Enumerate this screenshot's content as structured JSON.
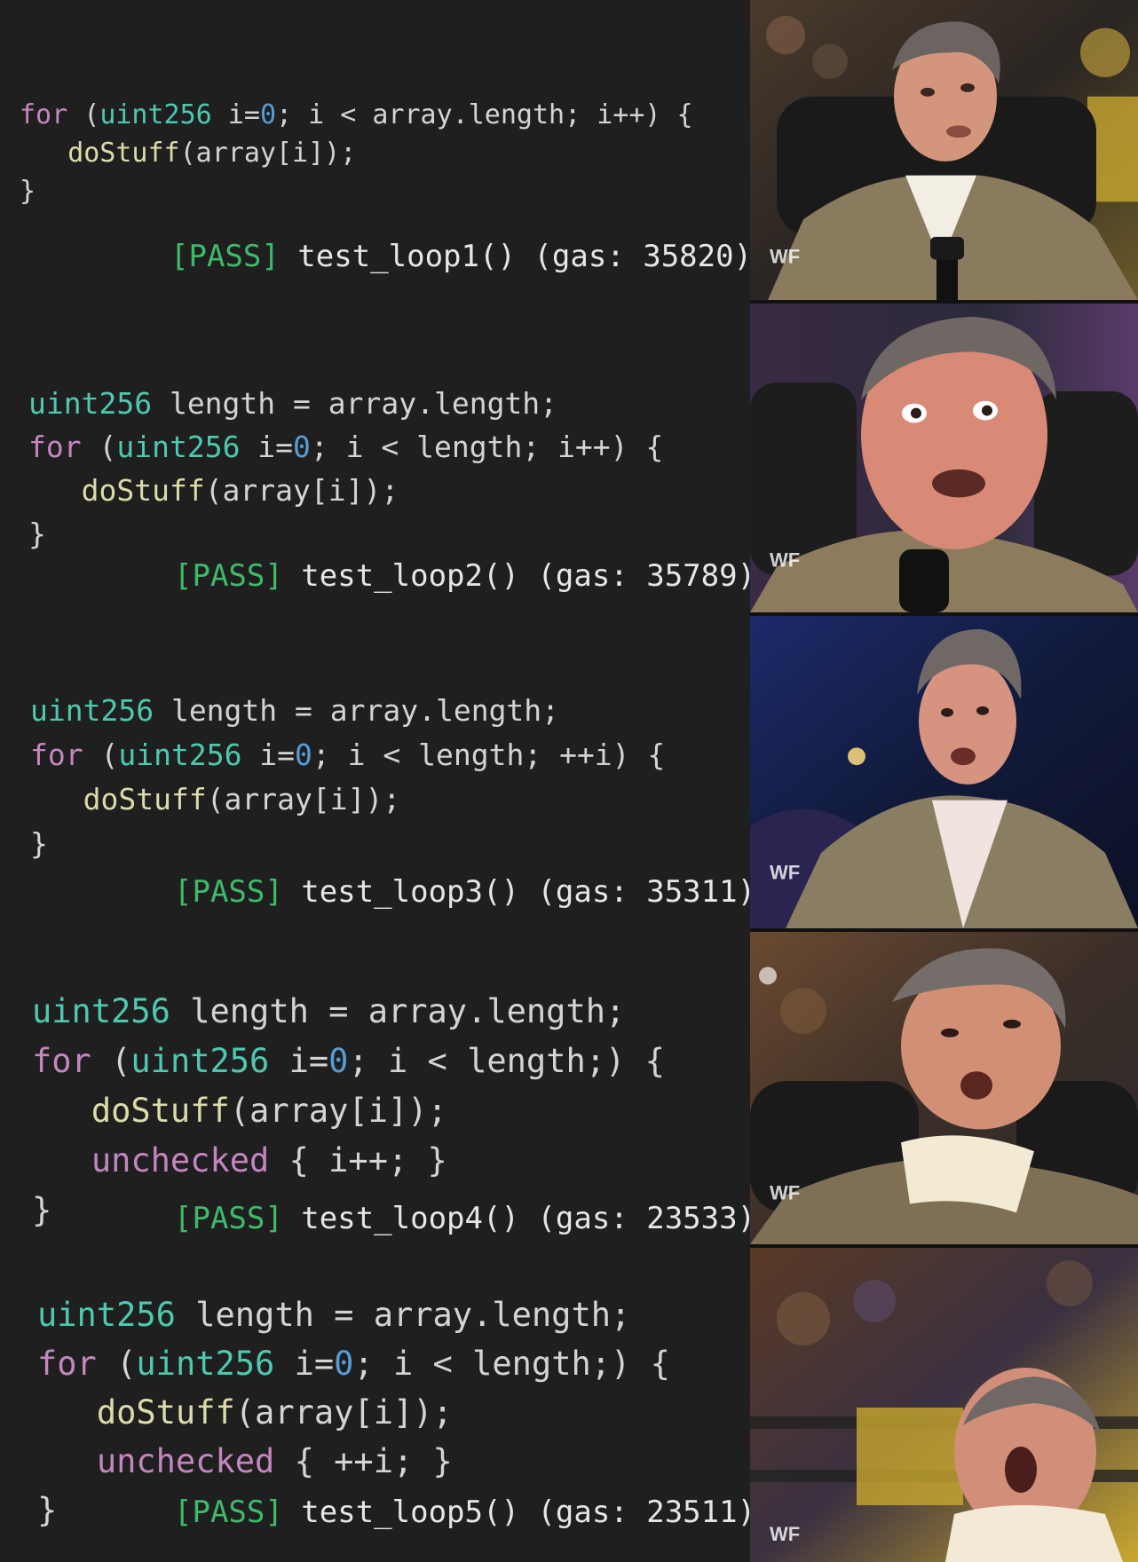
{
  "panels": [
    {
      "code_lines": [
        [
          {
            "t": "for",
            "c": "kw"
          },
          {
            "t": " (",
            "c": "pl"
          },
          {
            "t": "uint256",
            "c": "ty"
          },
          {
            "t": " i=",
            "c": "pl"
          },
          {
            "t": "0",
            "c": "nm"
          },
          {
            "t": "; i < array.length; i++) {",
            "c": "pl"
          }
        ],
        [
          {
            "t": "   ",
            "c": "pl"
          },
          {
            "t": "doStuff",
            "c": "fn"
          },
          {
            "t": "(array[i]);",
            "c": "pl"
          }
        ],
        [
          {
            "t": "}",
            "c": "pl"
          }
        ]
      ],
      "pass": "[PASS]",
      "test": " test_loop1() (gas: 35820)"
    },
    {
      "code_lines": [
        [
          {
            "t": "uint256",
            "c": "ty"
          },
          {
            "t": " length = array.length;",
            "c": "pl"
          }
        ],
        [
          {
            "t": "for",
            "c": "kw"
          },
          {
            "t": " (",
            "c": "pl"
          },
          {
            "t": "uint256",
            "c": "ty"
          },
          {
            "t": " i=",
            "c": "pl"
          },
          {
            "t": "0",
            "c": "nm"
          },
          {
            "t": "; i < length; i++) {",
            "c": "pl"
          }
        ],
        [
          {
            "t": "   ",
            "c": "pl"
          },
          {
            "t": "doStuff",
            "c": "fn"
          },
          {
            "t": "(array[i]);",
            "c": "pl"
          }
        ],
        [
          {
            "t": "}",
            "c": "pl"
          }
        ]
      ],
      "pass": "[PASS]",
      "test": " test_loop2() (gas: 35789)"
    },
    {
      "code_lines": [
        [
          {
            "t": "uint256",
            "c": "ty"
          },
          {
            "t": " length = array.length;",
            "c": "pl"
          }
        ],
        [
          {
            "t": "for",
            "c": "kw"
          },
          {
            "t": " (",
            "c": "pl"
          },
          {
            "t": "uint256",
            "c": "ty"
          },
          {
            "t": " i=",
            "c": "pl"
          },
          {
            "t": "0",
            "c": "nm"
          },
          {
            "t": "; i < length; ++i) {",
            "c": "pl"
          }
        ],
        [
          {
            "t": "   ",
            "c": "pl"
          },
          {
            "t": "doStuff",
            "c": "fn"
          },
          {
            "t": "(array[i]);",
            "c": "pl"
          }
        ],
        [
          {
            "t": "}",
            "c": "pl"
          }
        ]
      ],
      "pass": "[PASS]",
      "test": " test_loop3() (gas: 35311)"
    },
    {
      "code_lines": [
        [
          {
            "t": "uint256",
            "c": "ty"
          },
          {
            "t": " length = array.length;",
            "c": "pl"
          }
        ],
        [
          {
            "t": "for",
            "c": "kw"
          },
          {
            "t": " (",
            "c": "pl"
          },
          {
            "t": "uint256",
            "c": "ty"
          },
          {
            "t": " i=",
            "c": "pl"
          },
          {
            "t": "0",
            "c": "nm"
          },
          {
            "t": "; i < length;) {",
            "c": "pl"
          }
        ],
        [
          {
            "t": "   ",
            "c": "pl"
          },
          {
            "t": "doStuff",
            "c": "fn"
          },
          {
            "t": "(array[i]);",
            "c": "pl"
          }
        ],
        [
          {
            "t": "   ",
            "c": "pl"
          },
          {
            "t": "unchecked",
            "c": "kw"
          },
          {
            "t": " { i++; }",
            "c": "pl"
          }
        ],
        [
          {
            "t": "}",
            "c": "pl"
          }
        ]
      ],
      "pass": "[PASS]",
      "test": " test_loop4() (gas: 23533)"
    },
    {
      "code_lines": [
        [
          {
            "t": "uint256",
            "c": "ty"
          },
          {
            "t": " length = array.length;",
            "c": "pl"
          }
        ],
        [
          {
            "t": "for",
            "c": "kw"
          },
          {
            "t": " (",
            "c": "pl"
          },
          {
            "t": "uint256",
            "c": "ty"
          },
          {
            "t": " i=",
            "c": "pl"
          },
          {
            "t": "0",
            "c": "nm"
          },
          {
            "t": "; i < length;) {",
            "c": "pl"
          }
        ],
        [
          {
            "t": "   ",
            "c": "pl"
          },
          {
            "t": "doStuff",
            "c": "fn"
          },
          {
            "t": "(array[i]);",
            "c": "pl"
          }
        ],
        [
          {
            "t": "   ",
            "c": "pl"
          },
          {
            "t": "unchecked",
            "c": "kw"
          },
          {
            "t": " { ++i; }",
            "c": "pl"
          }
        ],
        [
          {
            "t": "}",
            "c": "pl"
          }
        ]
      ],
      "pass": "[PASS]",
      "test": " test_loop5() (gas: 23511)"
    }
  ],
  "photos": [
    {
      "icon": "surprised-man-photo",
      "watermark": "WF"
    },
    {
      "icon": "shocked-man-photo",
      "watermark": "WF"
    },
    {
      "icon": "amazed-man-photo",
      "watermark": "WF"
    },
    {
      "icon": "ecstatic-man-photo",
      "watermark": "WF"
    },
    {
      "icon": "euphoric-man-photo",
      "watermark": "WF"
    }
  ],
  "colors": {
    "keyword": "#c586c0",
    "type": "#4ec9b0",
    "function": "#dcdcaa",
    "number": "#569cd6",
    "pass": "#3dbb6a",
    "background": "#1f1f1f"
  }
}
